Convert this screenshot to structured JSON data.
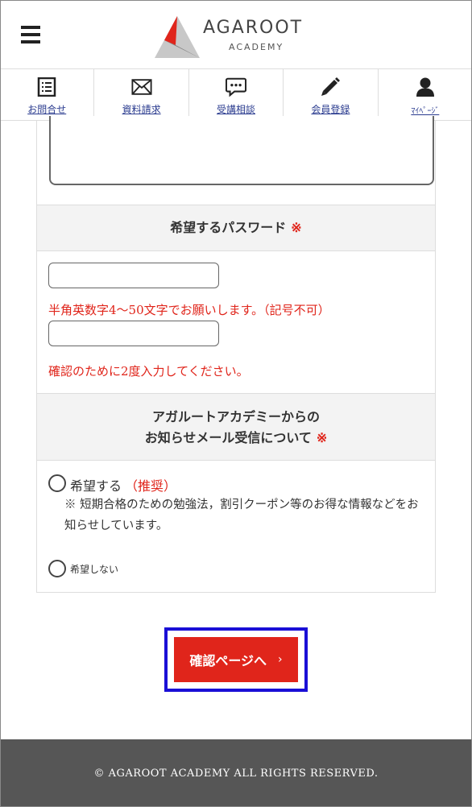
{
  "header": {
    "logo_name": "AGAROOT",
    "logo_sub": "ACADEMY"
  },
  "nav": {
    "items": [
      {
        "label": "お問合せ",
        "icon": "list-icon"
      },
      {
        "label": "資料請求",
        "icon": "envelope-icon"
      },
      {
        "label": "受講相談",
        "icon": "chat-icon"
      },
      {
        "label": "会員登録",
        "icon": "pencil-icon"
      },
      {
        "label": "ﾏｲﾍﾟｰｼﾞ",
        "icon": "user-icon"
      }
    ]
  },
  "password": {
    "heading": "希望するパスワード",
    "required_mark": "※",
    "input_value": "",
    "hint": "半角英数字4〜50文字でお願いします。（記号不可）",
    "confirm_value": "",
    "confirm_hint": "確認のために2度入力してください。"
  },
  "newsletter": {
    "heading_line1": "アガルートアカデミーからの",
    "heading_line2": "お知らせメール受信について",
    "required_mark": "※",
    "option_yes": "希望する",
    "option_yes_tag": "（推奨）",
    "option_yes_note": "※ 短期合格のための勉強法，割引クーポン等のお得な情報などをお知らせしています。",
    "option_no": "希望しない"
  },
  "submit": {
    "label": "確認ページへ",
    "chevron": "›"
  },
  "footer": {
    "copyright": "© AGAROOT ACADEMY ALL RIGHTS RESERVED."
  },
  "colors": {
    "accent": "#e0251b",
    "link": "#2a3b8f",
    "highlight_border": "#1a0fd6",
    "footer_bg": "#565656"
  }
}
